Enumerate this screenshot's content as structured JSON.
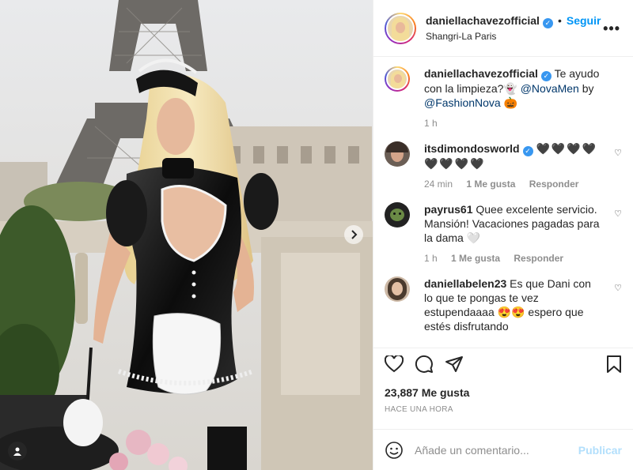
{
  "post": {
    "username": "daniellachavezofficial",
    "follow_label": "Seguir",
    "separator": "•",
    "location": "Shangri-La Paris",
    "more_label": "•••"
  },
  "caption": {
    "username": "daniellachavezofficial",
    "text_before": "Te ayudo con la limpieza?",
    "ghost_emoji": "👻",
    "mention_1": "@NovaMen",
    "by_text": "by",
    "mention_2": "@FashionNova",
    "pumpkin_emoji": "🎃",
    "time": "1 h"
  },
  "comments": [
    {
      "username": "itsdimondosworld",
      "verified": true,
      "text": "🖤🖤🖤🖤 🖤🖤🖤🖤",
      "time": "24 min",
      "likes": "1 Me gusta",
      "reply": "Responder"
    },
    {
      "username": "payrus61",
      "text": "Quee excelente servicio. Mansión! Vacaciones pagadas para la dama",
      "emoji": "🤍",
      "time": "1 h",
      "likes": "1 Me gusta",
      "reply": "Responder"
    },
    {
      "username": "daniellabelen23",
      "text_before": "Es que Dani con lo que te pongas te vez estupendaaaa",
      "emoji": "😍😍",
      "text_after": "espero que estés disfrutando"
    }
  ],
  "actions": {
    "like_icon": "heart-outline-icon",
    "comment_icon": "comment-icon",
    "share_icon": "paper-plane-icon",
    "save_icon": "bookmark-icon",
    "likes_count": "23,887 Me gusta",
    "posted_ago": "HACE UNA HORA"
  },
  "composer": {
    "placeholder": "Añade un comentario...",
    "publish_label": "Publicar"
  },
  "colors": {
    "accent": "#0095f6",
    "verified": "#3897f0",
    "muted": "#8e8e8e",
    "publish_disabled": "#b2dffc"
  }
}
